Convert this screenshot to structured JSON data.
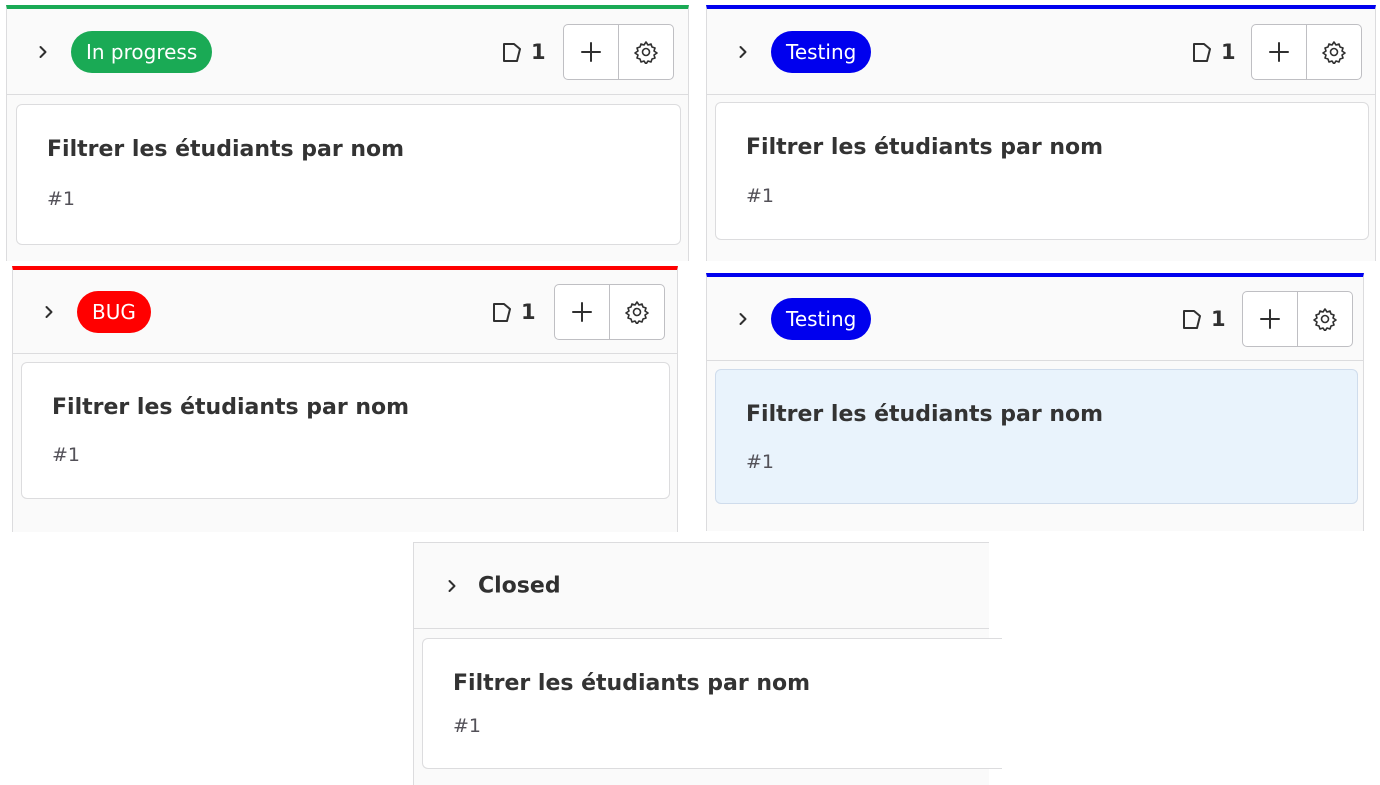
{
  "colors": {
    "green": "#1aaa55",
    "blue": "#0000ee",
    "red": "#ff0000"
  },
  "lists": [
    {
      "id": "in-progress",
      "label": "In progress",
      "label_color": "#1aaa55",
      "count": "1",
      "card": {
        "title": "Filtrer les étudiants par nom",
        "ref": "#1"
      }
    },
    {
      "id": "testing-1",
      "label": "Testing",
      "label_color": "#0000ee",
      "count": "1",
      "card": {
        "title": "Filtrer les étudiants par nom",
        "ref": "#1"
      }
    },
    {
      "id": "bug",
      "label": "BUG",
      "label_color": "#ff0000",
      "count": "1",
      "card": {
        "title": "Filtrer les étudiants par nom",
        "ref": "#1"
      }
    },
    {
      "id": "testing-2",
      "label": "Testing",
      "label_color": "#0000ee",
      "count": "1",
      "card": {
        "title": "Filtrer les étudiants par nom",
        "ref": "#1"
      }
    },
    {
      "id": "closed",
      "label": "Closed",
      "card": {
        "title": "Filtrer les étudiants par nom",
        "ref": "#1"
      }
    }
  ],
  "icons": {
    "expand": "chevron-right-icon",
    "issues": "issue-count-icon",
    "add": "plus-icon",
    "settings": "gear-icon"
  }
}
